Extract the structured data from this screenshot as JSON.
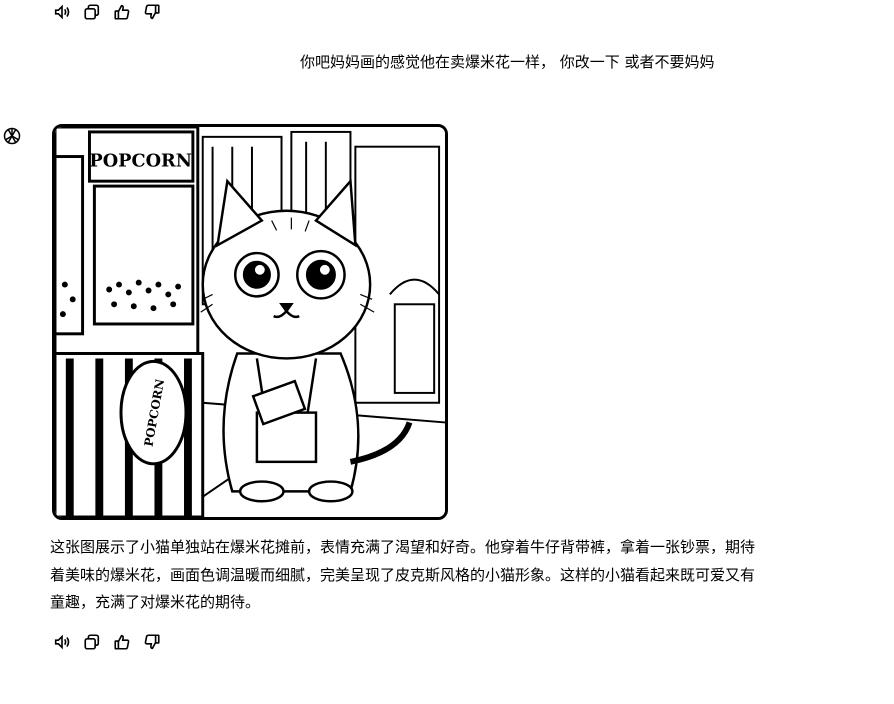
{
  "actions": {
    "read_aloud": "speaker-icon",
    "copy": "copy-icon",
    "like": "thumbs-up-icon",
    "dislike": "thumbs-down-icon"
  },
  "user_message": "你吧妈妈画的感觉他在卖爆米花一样， 你改一下 或者不要妈妈",
  "assistant": {
    "avatar_icon": "openai-logo-icon",
    "image": {
      "sign_top": "POPCORN",
      "sign_round": "POPCORN"
    },
    "text": "这张图展示了小猫单独站在爆米花摊前，表情充满了渴望和好奇。他穿着牛仔背带裤，拿着一张钞票，期待着美味的爆米花，画面色调温暖而细腻，完美呈现了皮克斯风格的小猫形象。这样的小猫看起来既可爱又有童趣，充满了对爆米花的期待。"
  },
  "colors": {
    "ink": "#000000",
    "background": "#ffffff"
  }
}
